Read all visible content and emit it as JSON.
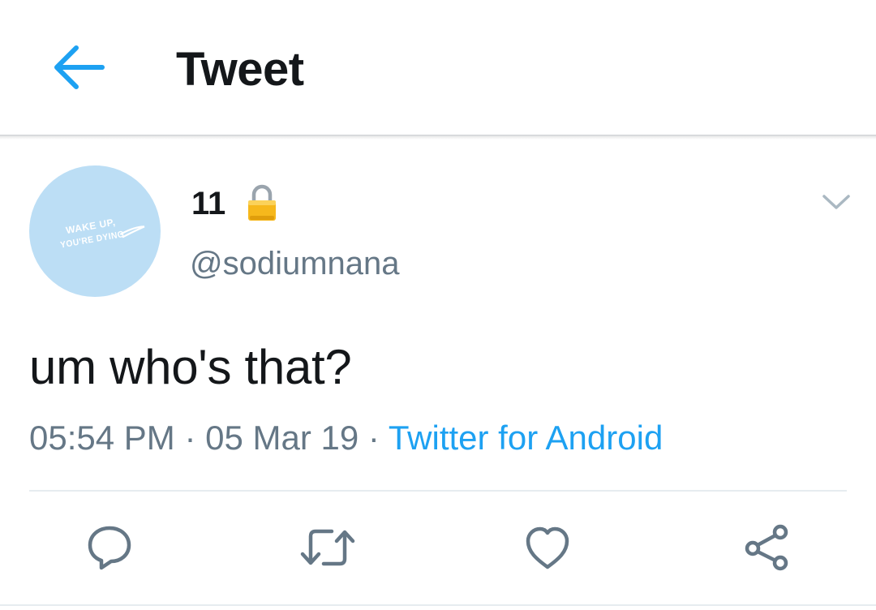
{
  "header": {
    "title": "Tweet",
    "back_icon": "back-arrow-icon"
  },
  "tweet": {
    "avatar_text_line1": "WAKE UP,",
    "avatar_text_line2": "YOU'RE DYING",
    "display_name": "11",
    "protected_icon": "lock-icon",
    "username": "@sodiumnana",
    "text": "um who's that?",
    "time": "05:54 PM",
    "date": "05 Mar 19",
    "separator": "·",
    "source": "Twitter for Android",
    "menu_icon": "chevron-down-icon"
  },
  "actions": [
    {
      "name": "reply",
      "icon": "reply-icon"
    },
    {
      "name": "retweet",
      "icon": "retweet-icon"
    },
    {
      "name": "like",
      "icon": "heart-icon"
    },
    {
      "name": "share",
      "icon": "share-icon"
    }
  ],
  "colors": {
    "accent": "#1da1f2",
    "text_primary": "#14171a",
    "text_secondary": "#657786",
    "avatar_bg": "#bcdef5",
    "divider": "#e6ecf0"
  }
}
